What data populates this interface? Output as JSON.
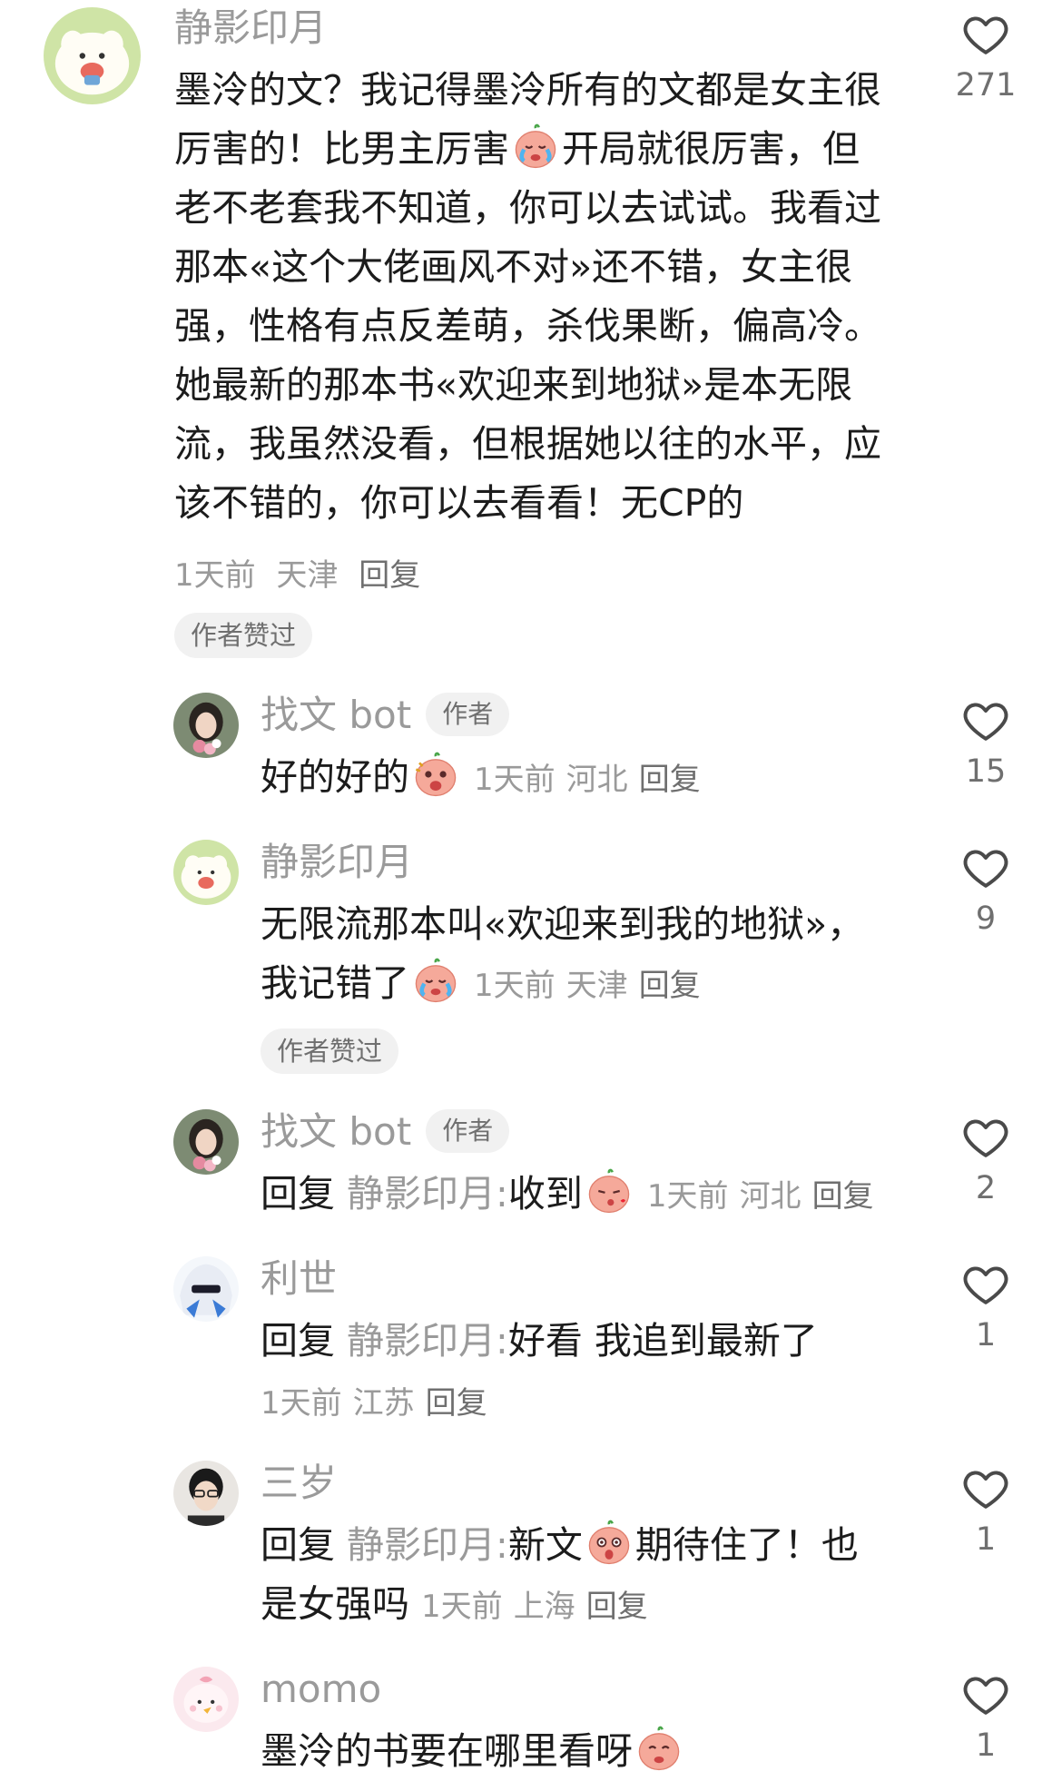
{
  "comments": [
    {
      "name": "静影印月",
      "lines": [
        "墨泠的文？我记得墨泠所有的文都是女主很",
        "厉害的！比男主厉害",
        "开局就很厉害，但",
        "老不老套我不知道，你可以去试试。我看过",
        "那本«这个大佬画风不对»还不错，女主很",
        "强，性格有点反差萌，杀伐果断，偏高冷。",
        "她最新的那本书«欢迎来到地狱»是本无限",
        "流，我虽然没看，但根据她以往的水平，应",
        "该不错的，你可以去看看！无CP的"
      ],
      "time": "1天前",
      "location": "天津",
      "reply": "回复",
      "author_liked": "作者赞过",
      "likes": "271"
    },
    {
      "name": "找文 bot",
      "tag": "作者",
      "text": "好的好的",
      "time": "1天前",
      "location": "河北",
      "reply": "回复",
      "likes": "15"
    },
    {
      "name": "静影印月",
      "line1": "无限流那本叫«欢迎来到我的地狱»，",
      "line2": "我记错了",
      "time": "1天前",
      "location": "天津",
      "reply": "回复",
      "author_liked": "作者赞过",
      "likes": "9"
    },
    {
      "name": "找文 bot",
      "tag": "作者",
      "reply_prefix": "回复",
      "reply_to": "静影印月:",
      "text": "收到",
      "time": "1天前",
      "location": "河北",
      "reply": "回复",
      "likes": "2"
    },
    {
      "name": "利世",
      "reply_prefix": "回复",
      "reply_to": "静影印月:",
      "text": "好看 我追到最新了",
      "time": "1天前",
      "location": "江苏",
      "reply": "回复",
      "likes": "1"
    },
    {
      "name": "三岁",
      "reply_prefix": "回复",
      "reply_to": "静影印月:",
      "text_a": "新文",
      "text_b": "期待住了！也",
      "line2": "是女强吗",
      "time": "1天前",
      "location": "上海",
      "reply": "回复",
      "likes": "1"
    },
    {
      "name": "momo",
      "text": "墨泠的书要在哪里看呀",
      "likes": "1"
    }
  ],
  "colors": {
    "text": "#1c1c1c",
    "secondary": "#9a9a9a",
    "badge_bg": "#f1f1f1",
    "heart": "#4a4a4a"
  },
  "icons": [
    "heart-icon",
    "crying-emoji-icon",
    "shocked-emoji-icon",
    "kiss-emoji-icon",
    "surprised-emoji-icon"
  ]
}
